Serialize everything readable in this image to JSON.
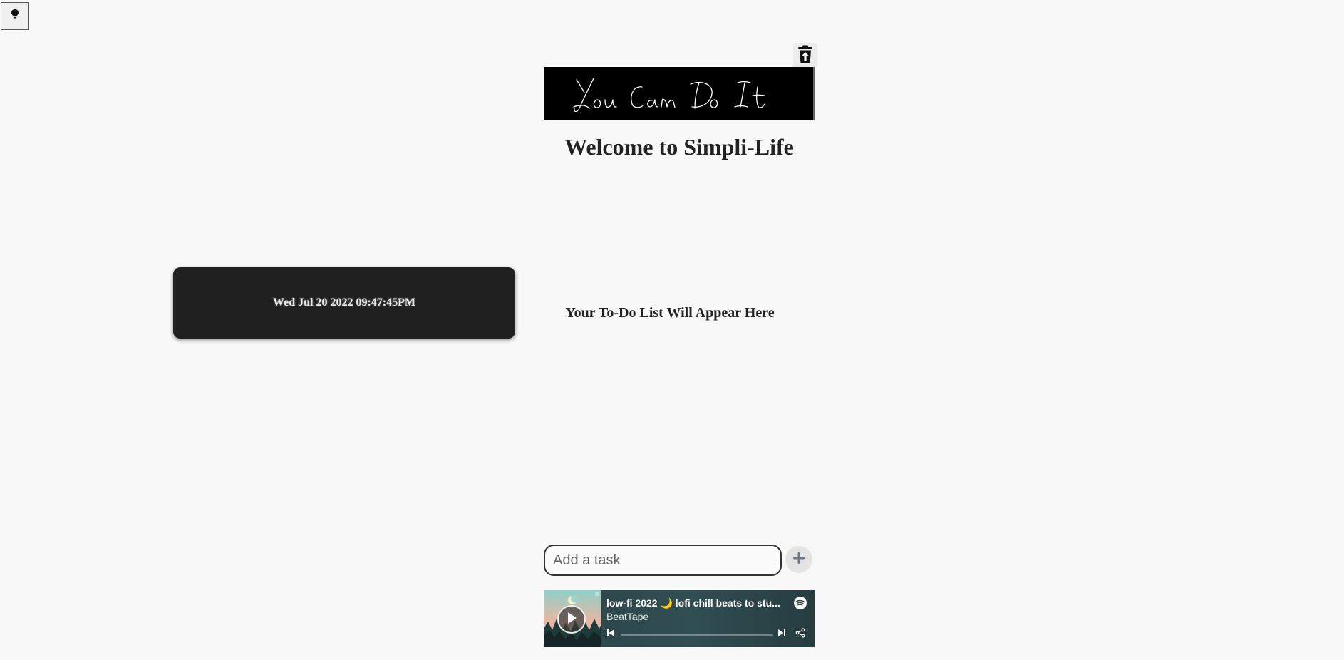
{
  "header": {
    "theme_toggle_icon": "lightbulb-icon",
    "clear_tasks_icon": "trash-upload-icon",
    "motivation_banner_text": "You Can Do It",
    "page_title": "Welcome to Simpli-Life"
  },
  "clock": {
    "datetime": "Wed Jul 20 2022 09:47:45PM"
  },
  "todo": {
    "empty_message": "Your To-Do List Will Appear Here",
    "input_value": "",
    "input_placeholder": "Add a task",
    "add_icon": "plus-icon"
  },
  "player": {
    "track_title": "low-fi 2022 🌙 lofi chill beats to stu...",
    "artist": "BeatTape",
    "progress": 0,
    "brand_icon": "spotify-icon",
    "play_icon": "play-icon",
    "prev_icon": "skip-back-icon",
    "next_icon": "skip-forward-icon",
    "share_icon": "share-icon"
  },
  "colors": {
    "page_background": "#f8f8f8",
    "clock_background": "#202020",
    "banner_background": "#000000",
    "player_background": "#314e52"
  }
}
